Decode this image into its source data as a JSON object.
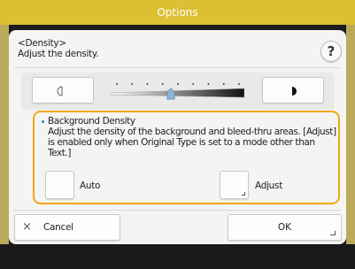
{
  "header": {
    "title": "Options"
  },
  "dialog": {
    "title": "<Density>",
    "subtitle": "Adjust the density.",
    "help_label": "?",
    "density_slider": {
      "ticks": 9,
      "selected_index": 4
    },
    "background_density": {
      "title": "Background Density",
      "description": "Adjust the density of the background and bleed-thru areas. [Adjust] is enabled only when Original Type is set to a mode other than Text.]",
      "auto_label": "Auto",
      "adjust_label": "Adjust"
    },
    "footer": {
      "cancel_icon": "×",
      "cancel_label": "Cancel",
      "ok_label": "OK"
    }
  },
  "colors": {
    "header": "#dcbf33",
    "highlight_border": "#f2a51c",
    "bullet": "#2a7fc5"
  }
}
